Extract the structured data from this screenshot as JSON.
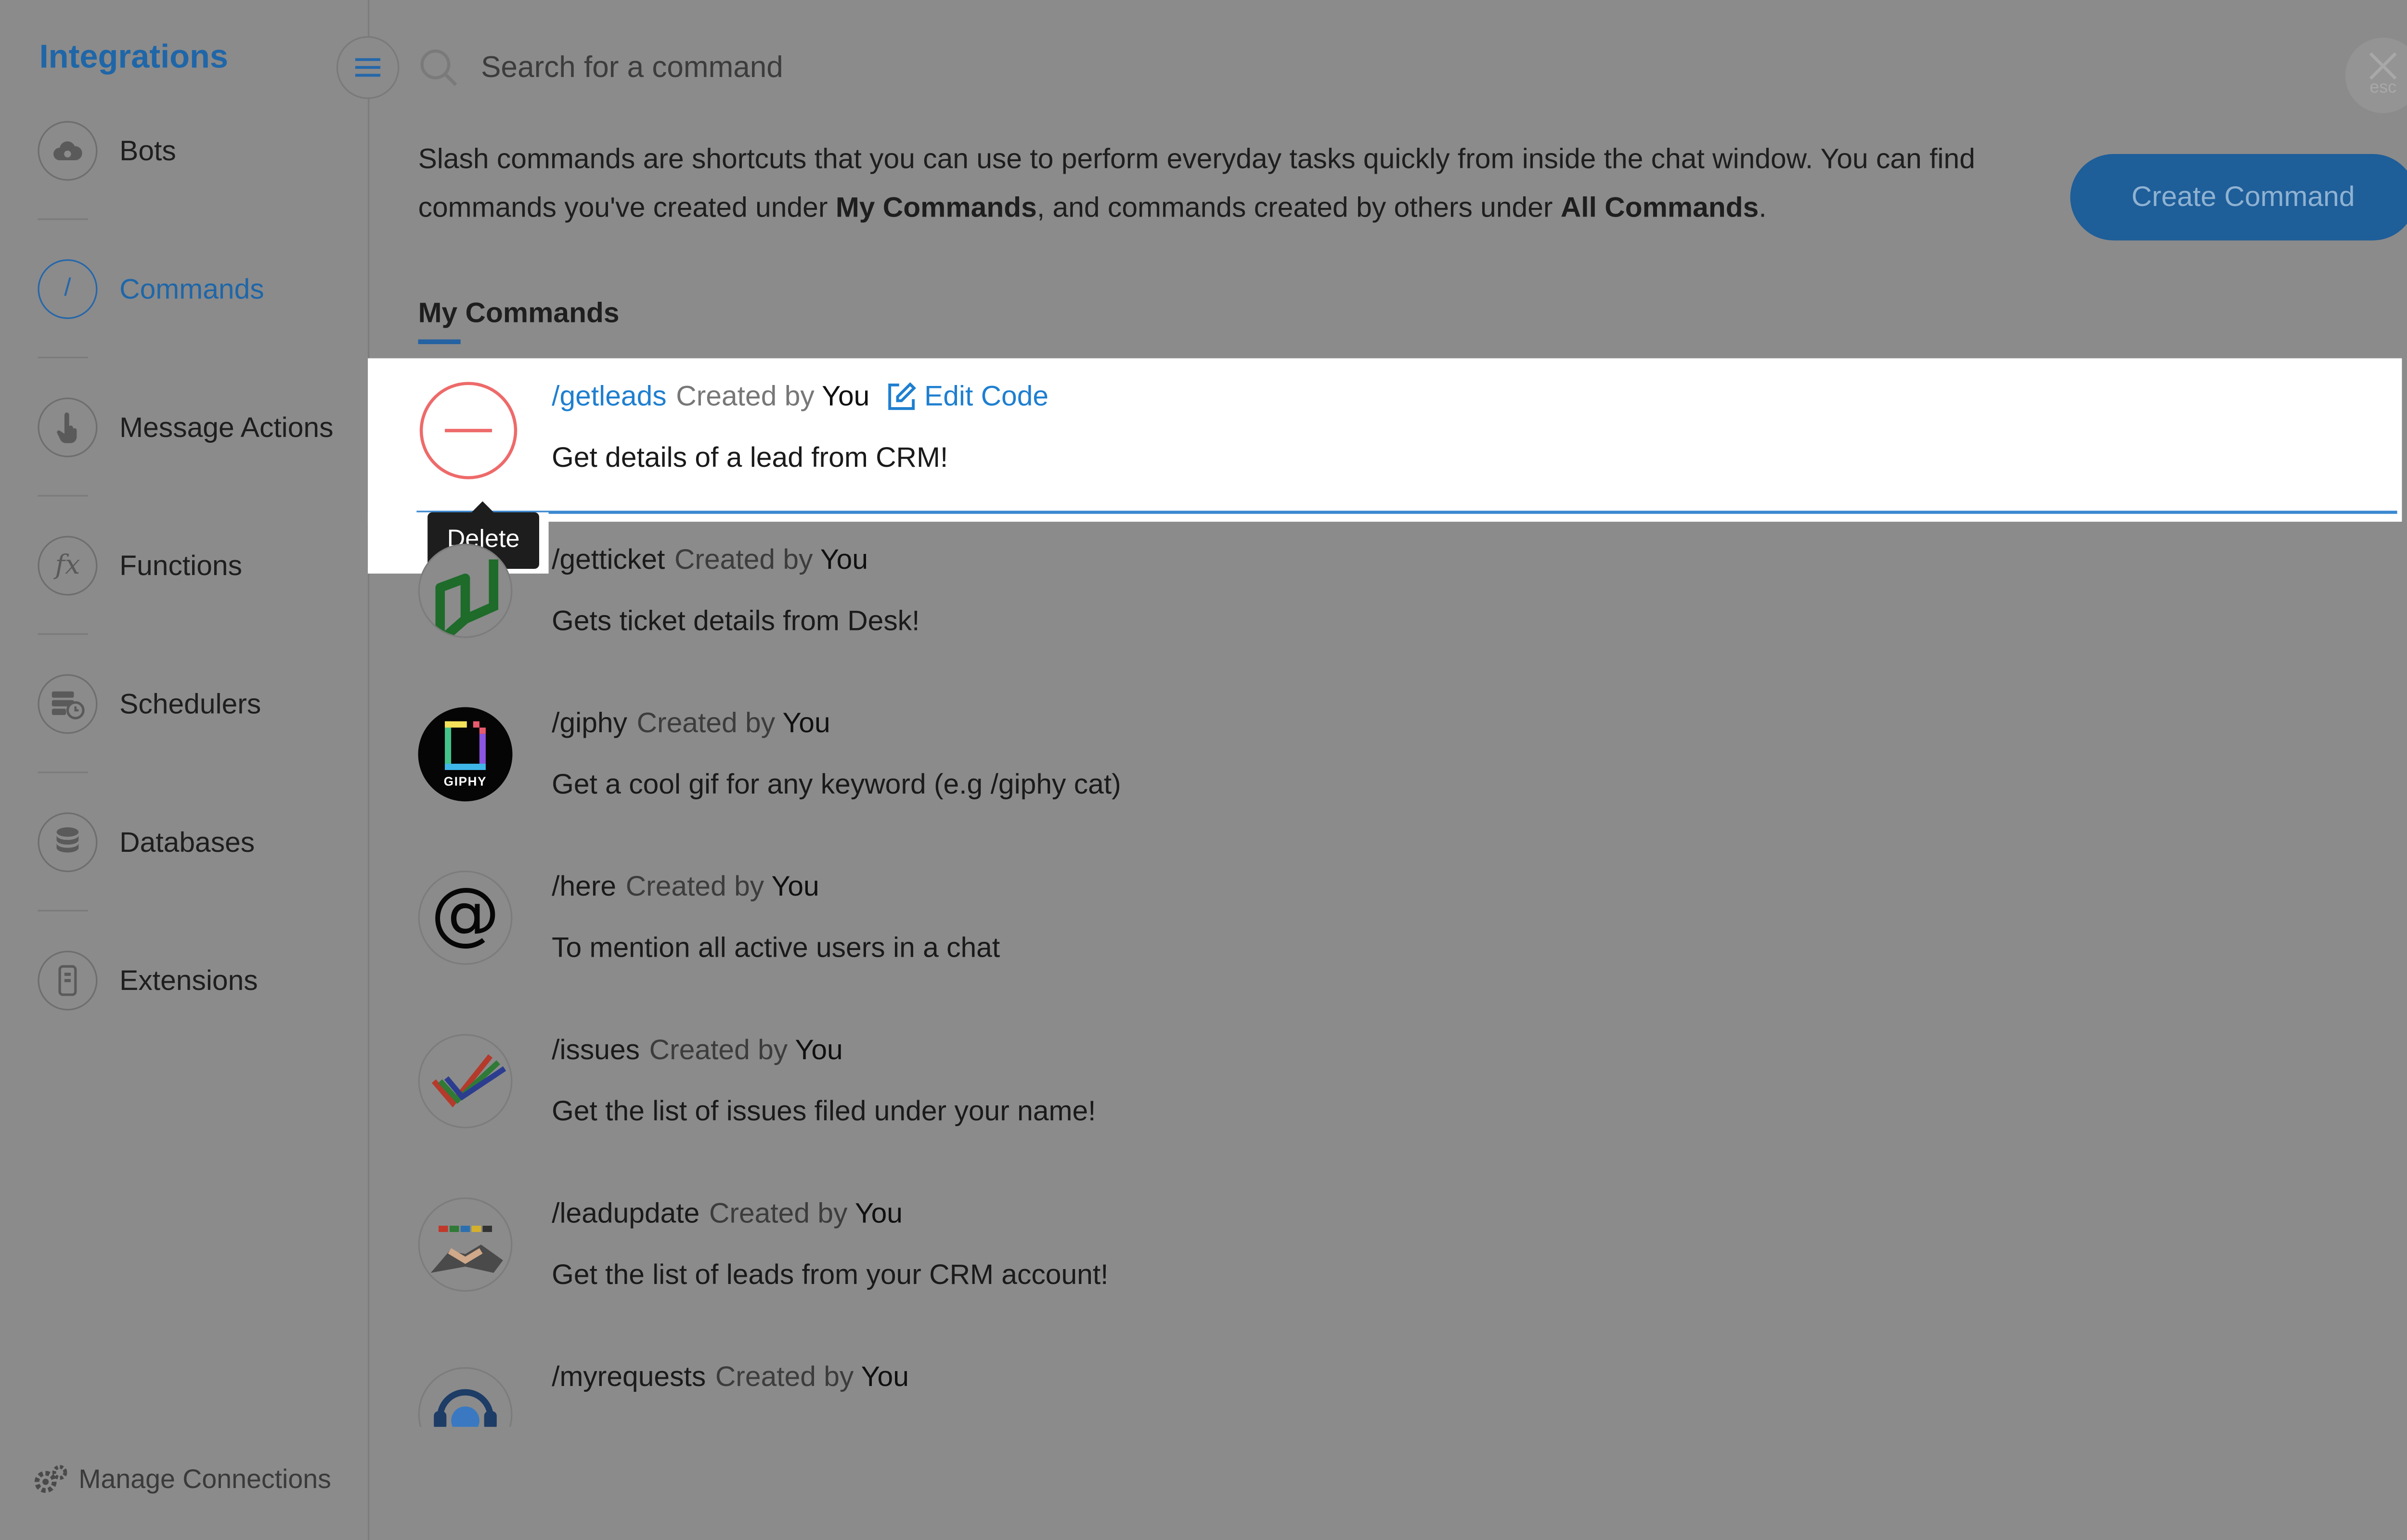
{
  "sidebar": {
    "title": "Integrations",
    "items": [
      {
        "label": "Bots",
        "icon": "cloud-eye-icon",
        "active": false
      },
      {
        "label": "Commands",
        "icon": "slash-icon",
        "active": true
      },
      {
        "label": "Message Actions",
        "icon": "pointer-hand-icon",
        "active": false
      },
      {
        "label": "Functions",
        "icon": "fx-icon",
        "active": false
      },
      {
        "label": "Schedulers",
        "icon": "scheduler-clock-icon",
        "active": false
      },
      {
        "label": "Databases",
        "icon": "database-icon",
        "active": false
      },
      {
        "label": "Extensions",
        "icon": "extension-device-icon",
        "active": false
      }
    ],
    "slash_glyph": "/",
    "fx_glyph": "fx",
    "manage_label": "Manage Connections"
  },
  "search": {
    "placeholder": "Search for a command"
  },
  "close": {
    "esc_label": "esc"
  },
  "description": {
    "part1": "Slash commands are shortcuts that you can use to perform everyday tasks quickly from inside the chat window. You can find commands you've created under ",
    "bold1": "My Commands",
    "part2": ", and commands created by others under ",
    "bold2": "All Commands",
    "part3": "."
  },
  "create_button": "Create Command",
  "section_tab": "My Commands",
  "created_by_label": "Created by",
  "edit_code_label": "Edit Code",
  "tooltip": "Delete",
  "commands": [
    {
      "name": "/getleads",
      "by": "You",
      "desc": "Get details of a lead from CRM!",
      "icon": "delete-circle-icon"
    },
    {
      "name": "/getticket",
      "by": "You",
      "desc": "Gets ticket details from Desk!",
      "icon": "desk-logo-icon"
    },
    {
      "name": "/giphy",
      "by": "You",
      "desc": "Get a cool gif for any keyword (e.g /giphy cat)",
      "icon": "giphy-logo-icon",
      "logo_text": "GIPHY"
    },
    {
      "name": "/here",
      "by": "You",
      "desc": "To mention all active users in a chat",
      "icon": "at-sign-icon",
      "glyph": "@"
    },
    {
      "name": "/issues",
      "by": "You",
      "desc": "Get the list of issues filed under your name!",
      "icon": "checkmarks-icon"
    },
    {
      "name": "/leadupdate",
      "by": "You",
      "desc": "Get the list of leads from your CRM account!",
      "icon": "handshake-icon"
    },
    {
      "name": "/myrequests",
      "by": "You",
      "desc": "",
      "icon": "headset-icon"
    }
  ]
}
